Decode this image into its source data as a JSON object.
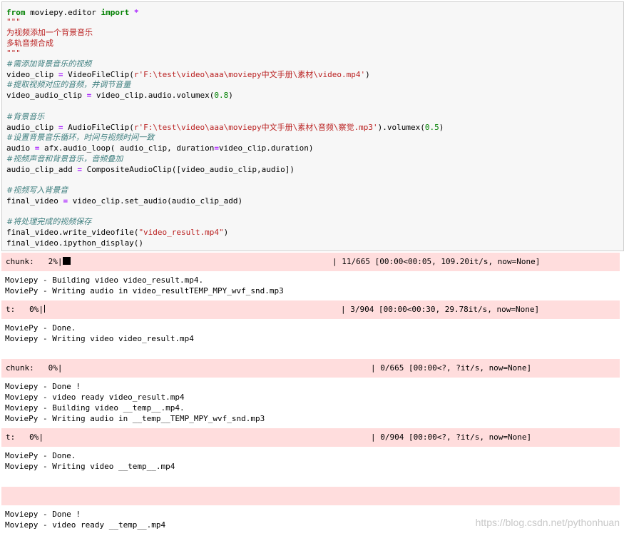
{
  "code": {
    "line1": {
      "kw1": "from",
      "mod": " moviepy.editor ",
      "kw2": "import",
      "star": " *"
    },
    "doc_open": "\"\"\"",
    "doc_line1": "为视频添加一个背景音乐",
    "doc_line2": "多轨音频合成",
    "doc_close": "\"\"\"",
    "c1": "#需添加背景音乐的视频",
    "l_video": {
      "pre": "video_clip ",
      "eq": "=",
      "call": " VideoFileClip(",
      "str": "r'F:\\test\\video\\aaa\\moviepy中文手册\\素材\\video.mp4'",
      "end": ")"
    },
    "c2": "#提取视频对应的音频，并调节音量",
    "l_vaudio": {
      "pre": "video_audio_clip ",
      "eq": "=",
      "call": " video_clip.audio.volumex(",
      "num": "0.8",
      "end": ")"
    },
    "c3": "#背景音乐",
    "l_audio": {
      "pre": "audio_clip ",
      "eq": "=",
      "call": " AudioFileClip(",
      "str": "r'F:\\test\\video\\aaa\\moviepy中文手册\\素材\\音频\\察觉.mp3'",
      "mid": ").volumex(",
      "num": "0.5",
      "end": ")"
    },
    "c4": "#设置背景音乐循环，时间与视频时间一致",
    "l_loop": {
      "pre": "audio ",
      "eq": "=",
      "call": " afx.audio_loop( audio_clip, duration",
      "eq2": "=",
      "end": "video_clip.duration)"
    },
    "c5": "#视频声音和背景音乐，音频叠加",
    "l_add": {
      "pre": "audio_clip_add ",
      "eq": "=",
      "end": " CompositeAudioClip([video_audio_clip,audio])"
    },
    "c6": "#视频写入背景音",
    "l_final": {
      "pre": "final_video ",
      "eq": "=",
      "end": " video_clip.set_audio(audio_clip_add)"
    },
    "c7": "#将处理完成的视频保存",
    "l_write": {
      "pre": "final_video.write_videofile(",
      "str": "\"video_result.mp4\"",
      "end": ")"
    },
    "l_display": "final_video.ipython_display()"
  },
  "outputs": {
    "pb1": {
      "label": "chunk:   2%|",
      "right": "| 11/665 [00:00<00:05, 109.20it/s, now=None]"
    },
    "out1": [
      "Moviepy - Building video video_result.mp4.",
      "MoviePy - Writing audio in video_resultTEMP_MPY_wvf_snd.mp3"
    ],
    "pb2": {
      "label": "t:   0%|",
      "right": "| 3/904 [00:00<00:30, 29.78it/s, now=None]"
    },
    "out2": [
      "MoviePy - Done.",
      "Moviepy - Writing video video_result.mp4"
    ],
    "pb3": {
      "label": "chunk:   0%|",
      "right": "| 0/665 [00:00<?, ?it/s, now=None]"
    },
    "out3": [
      "Moviepy - Done !",
      "Moviepy - video ready video_result.mp4",
      "Moviepy - Building video __temp__.mp4.",
      "MoviePy - Writing audio in __temp__TEMP_MPY_wvf_snd.mp3"
    ],
    "pb4": {
      "label": "t:   0%|",
      "right": "| 0/904 [00:00<?, ?it/s, now=None]"
    },
    "out4": [
      "MoviePy - Done.",
      "Moviepy - Writing video __temp__.mp4"
    ],
    "out5": [
      "Moviepy - Done !",
      "Moviepy - video ready __temp__.mp4"
    ]
  },
  "watermark": "https://blog.csdn.net/pythonhuan"
}
